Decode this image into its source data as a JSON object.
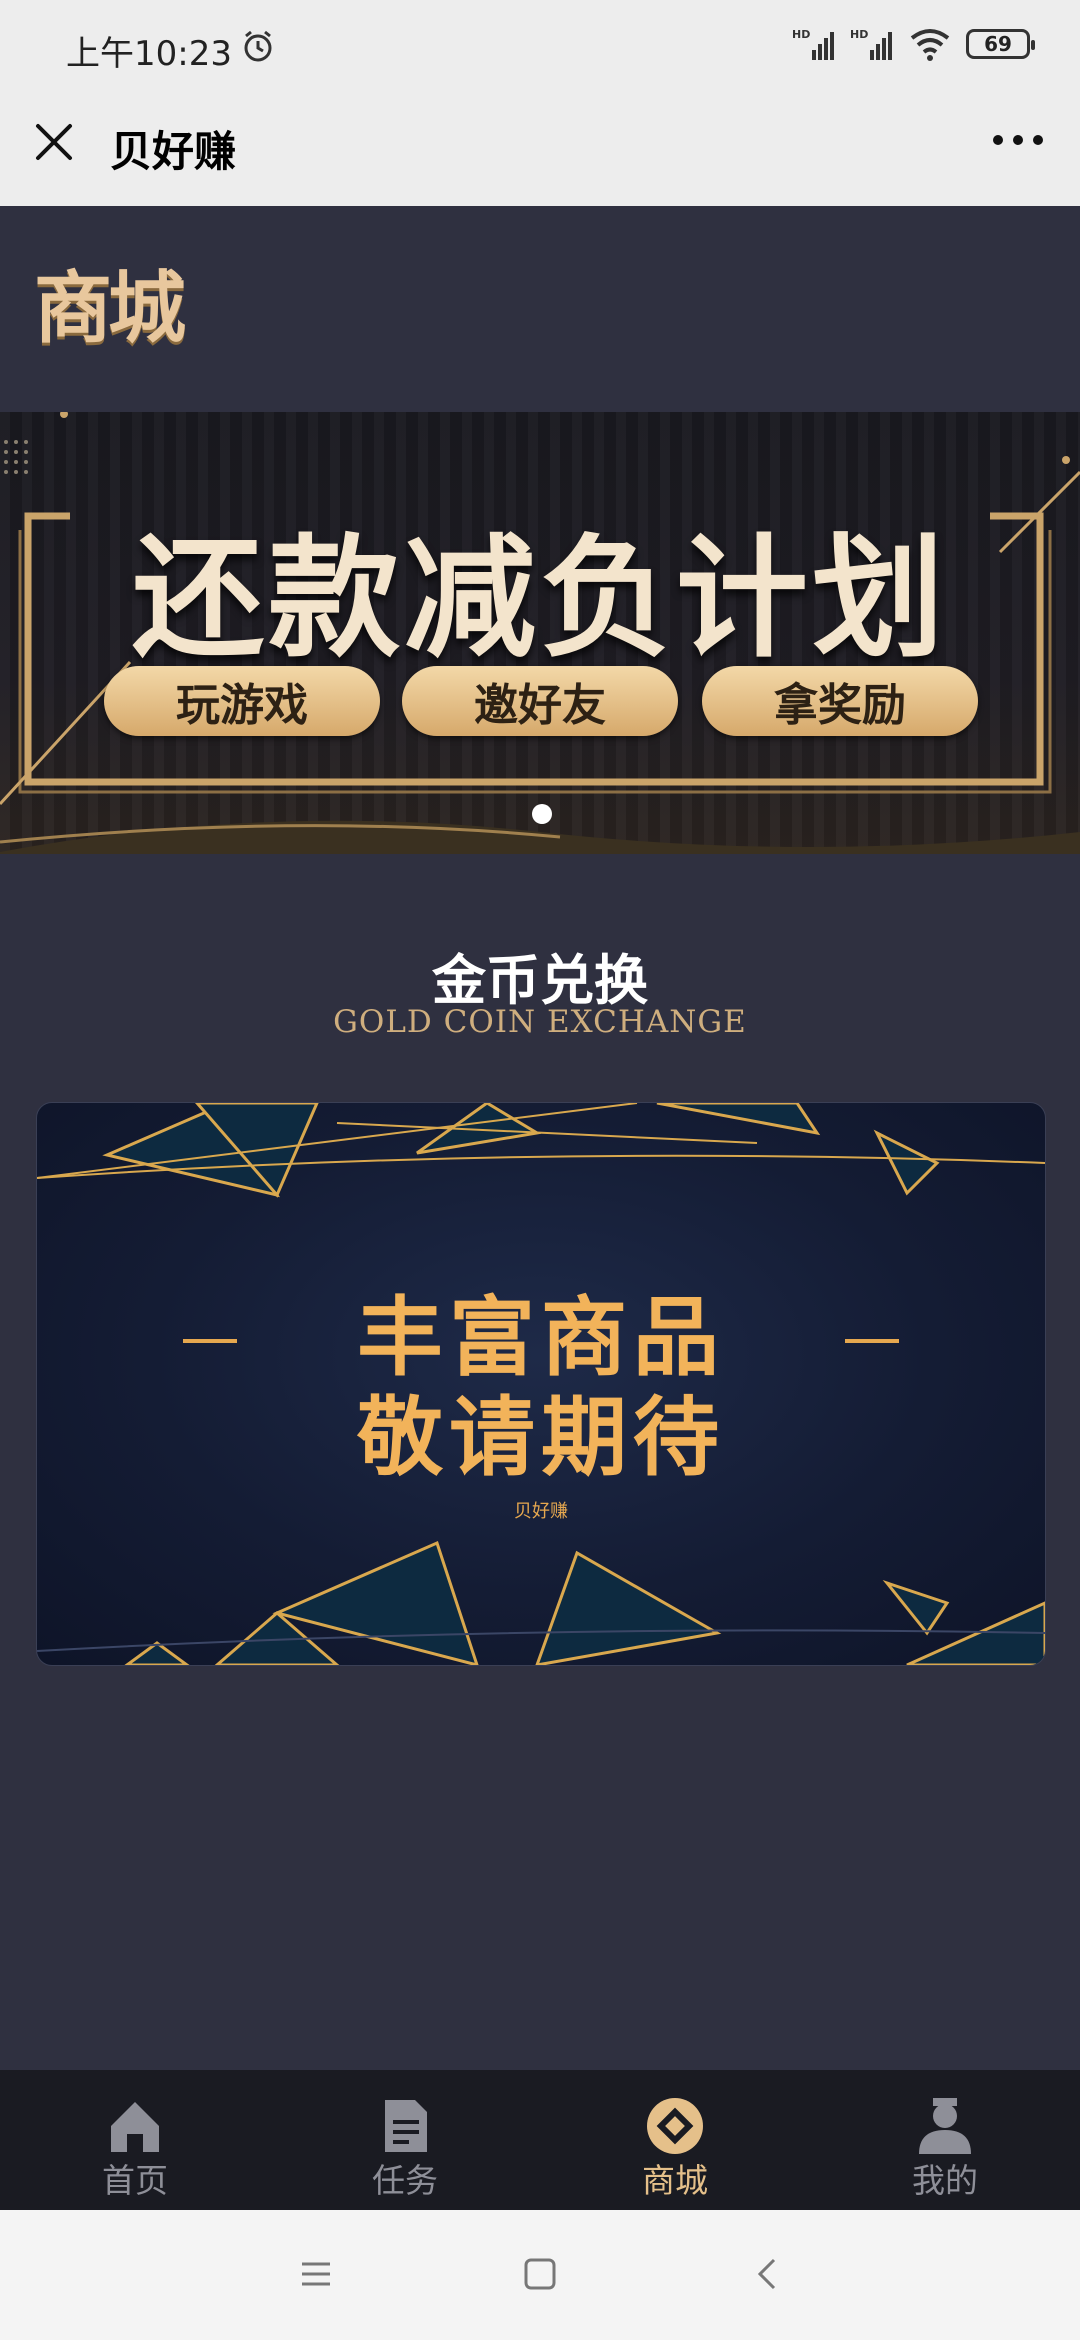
{
  "status_bar": {
    "time": "上午10:23",
    "signal_1_label": "HD",
    "signal_2_label": "HD",
    "battery": "69"
  },
  "title_bar": {
    "title": "贝好赚",
    "close_icon": "close-icon",
    "more_icon": "more-icon"
  },
  "header": {
    "logo_text": "商城"
  },
  "banner": {
    "title": "还款减负计划",
    "pills": [
      "玩游戏",
      "邀好友",
      "拿奖励"
    ],
    "active_dot": 1,
    "dot_count": 1
  },
  "section": {
    "title": "金币兑换",
    "subtitle": "GOLD COIN EXCHANGE"
  },
  "product_card": {
    "line1": "丰富商品",
    "line2": "敬请期待",
    "brand": "贝好赚"
  },
  "bottom_nav": {
    "items": [
      {
        "label": "首页",
        "icon": "home-icon"
      },
      {
        "label": "任务",
        "icon": "document-icon"
      },
      {
        "label": "商城",
        "icon": "mall-icon"
      },
      {
        "label": "我的",
        "icon": "user-icon"
      }
    ],
    "active_index": 2
  },
  "colors": {
    "background": "#2f3040",
    "accent_gold": "#e5c08a",
    "card_text": "#f2b35a",
    "nav_bg": "#1a1b22"
  }
}
